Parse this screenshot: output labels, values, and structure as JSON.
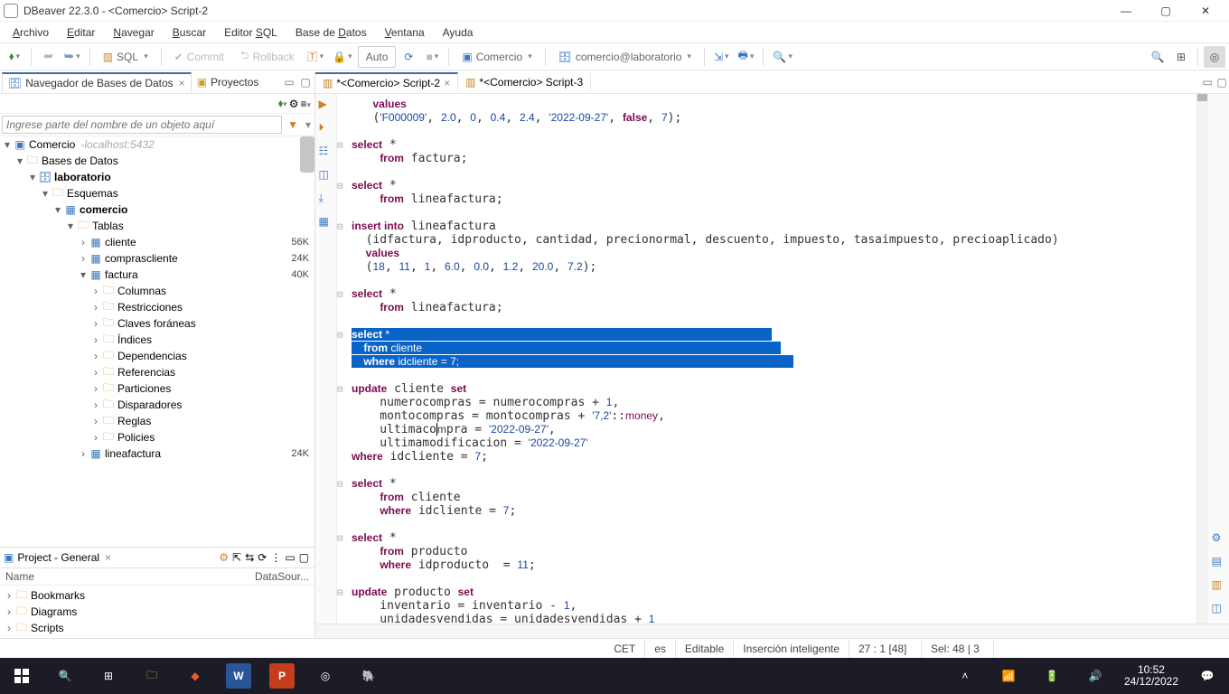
{
  "window": {
    "title": "DBeaver 22.3.0 - <Comercio> Script-2"
  },
  "menu": [
    "Archivo",
    "Editar",
    "Navegar",
    "Buscar",
    "Editor SQL",
    "Base de Datos",
    "Ventana",
    "Ayuda"
  ],
  "toolbar": {
    "sql": "SQL",
    "commit": "Commit",
    "rollback": "Rollback",
    "auto": "Auto",
    "conn": "Comercio",
    "db": "comercio@laboratorio"
  },
  "leftTabs": {
    "nav": "Navegador de Bases de Datos",
    "proj": "Proyectos"
  },
  "search": {
    "placeholder": "Ingrese parte del nombre de un objeto aquí"
  },
  "tree": {
    "root": "Comercio",
    "rootHost": "localhost:5432",
    "bases": "Bases de Datos",
    "lab": "laboratorio",
    "schemas": "Esquemas",
    "schema": "comercio",
    "tables": "Tablas",
    "items": [
      {
        "name": "cliente",
        "size": "56K"
      },
      {
        "name": "comprascliente",
        "size": "24K"
      },
      {
        "name": "factura",
        "size": "40K",
        "open": true,
        "children": [
          "Columnas",
          "Restricciones",
          "Claves foráneas",
          "Índices",
          "Dependencias",
          "Referencias",
          "Particiones",
          "Disparadores",
          "Reglas",
          "Policies"
        ]
      },
      {
        "name": "lineafactura",
        "size": "24K"
      }
    ]
  },
  "project": {
    "title": "Project - General",
    "colName": "Name",
    "colDS": "DataSour...",
    "items": [
      "Bookmarks",
      "Diagrams",
      "Scripts"
    ]
  },
  "editorTabs": [
    "*<Comercio> Script-2",
    "*<Comercio> Script-3"
  ],
  "status": {
    "tz": "CET",
    "lang": "es",
    "mode": "Editable",
    "insert": "Inserción inteligente",
    "pos": "27 : 1 [48]",
    "sel": "Sel: 48 | 3"
  },
  "taskbar": {
    "time": "10:52",
    "date": "24/12/2022"
  }
}
